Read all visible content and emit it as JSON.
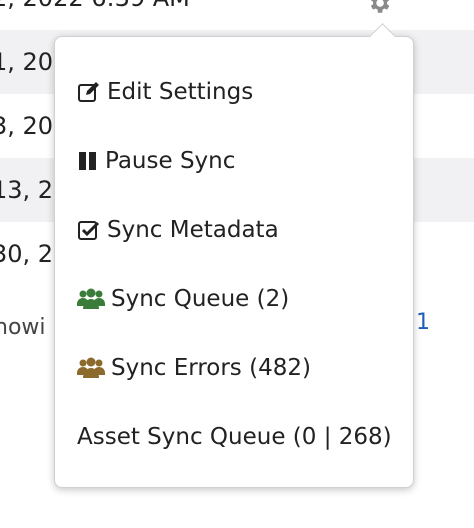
{
  "background": {
    "rows": [
      "2, 2022 6:39 AM",
      "1, 20",
      "3, 20",
      "13, 2",
      "30, 2"
    ],
    "footer_text": "howi",
    "footer_link": "1"
  },
  "menu": {
    "items": [
      {
        "label": "Edit Settings",
        "icon": "edit-icon",
        "color": "#222222"
      },
      {
        "label": "Pause Sync",
        "icon": "pause-icon",
        "color": "#222222"
      },
      {
        "label": "Sync Metadata",
        "icon": "check-square-icon",
        "color": "#222222"
      },
      {
        "label": "Sync Queue (2)",
        "icon": "users-icon",
        "color": "#3a7d3a"
      },
      {
        "label": "Sync Errors (482)",
        "icon": "users-icon",
        "color": "#8b6a2b"
      },
      {
        "label": "Asset Sync Queue (0 | 268)",
        "icon": "",
        "color": "#222222"
      }
    ]
  }
}
